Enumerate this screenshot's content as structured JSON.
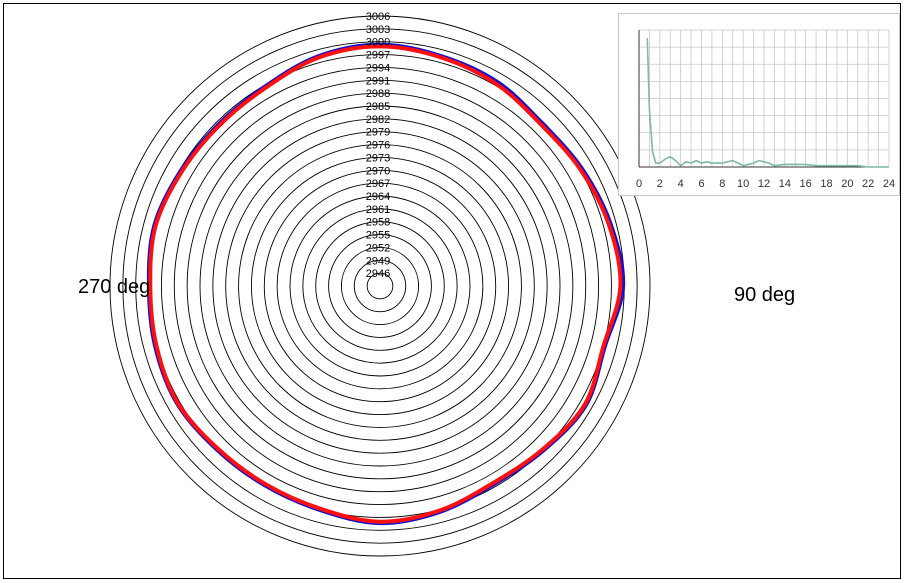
{
  "labels": {
    "left": "270 deg",
    "right": "90 deg"
  },
  "chart_data": [
    {
      "type": "polar-line",
      "radial_ticks": [
        "2946",
        "2949",
        "2952",
        "2955",
        "2958",
        "2961",
        "2964",
        "2967",
        "2970",
        "2973",
        "2976",
        "2979",
        "2982",
        "2985",
        "2988",
        "2991",
        "2994",
        "2997",
        "3000",
        "3003",
        "3006"
      ],
      "radial_range": [
        2943,
        3006
      ],
      "angle_labels": {
        "90": "90 deg",
        "270": "270 deg"
      },
      "series": [
        {
          "color": "#1010d0",
          "theta": [
            0,
            15,
            30,
            45,
            60,
            75,
            90,
            105,
            120,
            135,
            150,
            165,
            180,
            195,
            210,
            225,
            240,
            255,
            270,
            285,
            300,
            315,
            330,
            345
          ],
          "r": [
            2999.2,
            2998.4,
            2997.8,
            2996.5,
            2997.4,
            2998.6,
            2999.6,
            2997.2,
            2998.4,
            2997.0,
            2996.2,
            2997.4,
            2998.2,
            2997.0,
            2996.6,
            2996.8,
            2997.6,
            2997.2,
            2996.8,
            2997.4,
            2996.6,
            2996.2,
            2996.6,
            2998.4
          ]
        },
        {
          "color": "#ff1010",
          "theta": [
            0,
            15,
            30,
            45,
            60,
            75,
            90,
            105,
            120,
            135,
            150,
            165,
            180,
            195,
            210,
            225,
            240,
            255,
            270,
            285,
            300,
            315,
            330,
            345
          ],
          "r": [
            2998.9,
            2998.2,
            2997.4,
            2996.2,
            2997.1,
            2998.3,
            2999.1,
            2997.0,
            2998.2,
            2996.8,
            2996.0,
            2997.2,
            2998.0,
            2996.8,
            2996.4,
            2996.6,
            2997.5,
            2997.0,
            2996.6,
            2997.2,
            2996.4,
            2996.0,
            2996.4,
            2998.2
          ]
        }
      ]
    },
    {
      "type": "line",
      "x_ticks": [
        "0",
        "2",
        "4",
        "6",
        "8",
        "10",
        "12",
        "14",
        "16",
        "18",
        "20",
        "22",
        "24"
      ],
      "xlim": [
        0,
        24
      ],
      "ylim": [
        0,
        1
      ],
      "grid": true,
      "series": [
        {
          "color": "#7fb8a8",
          "x": [
            0.8,
            1.0,
            1.3,
            1.6,
            2,
            2.5,
            3,
            3.5,
            4,
            4.5,
            5,
            5.5,
            6,
            6.5,
            7,
            7.5,
            8,
            8.5,
            9,
            9.5,
            10,
            10.5,
            11,
            11.5,
            12,
            12.5,
            13,
            14,
            15,
            16,
            17,
            18,
            19,
            20,
            21,
            22,
            23,
            24
          ],
          "y": [
            1.0,
            0.45,
            0.12,
            0.03,
            0.03,
            0.06,
            0.08,
            0.05,
            0.01,
            0.04,
            0.03,
            0.05,
            0.03,
            0.04,
            0.03,
            0.03,
            0.03,
            0.04,
            0.05,
            0.03,
            0.01,
            0.02,
            0.03,
            0.05,
            0.04,
            0.03,
            0.01,
            0.02,
            0.02,
            0.02,
            0.01,
            0.01,
            0.01,
            0.01,
            0.01,
            0.0,
            0.0,
            0.0
          ]
        }
      ]
    }
  ]
}
